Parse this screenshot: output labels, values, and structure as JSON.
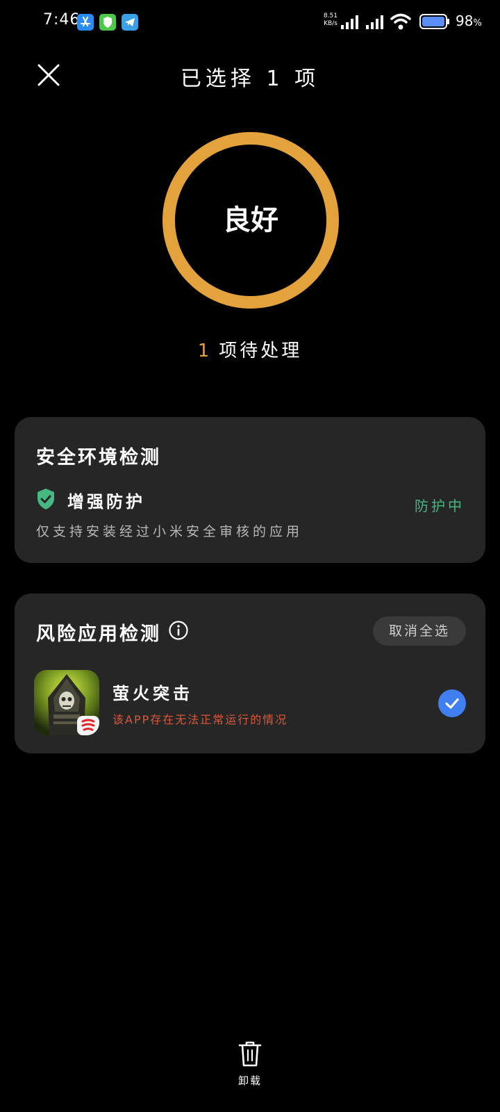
{
  "status_bar": {
    "time": "7:46",
    "network_speed_value": "8.51",
    "network_speed_unit": "KB/s",
    "battery_percent": "98",
    "battery_unit": "%",
    "notification_icons": [
      "app-store-icon",
      "shield-app-icon",
      "telegram-icon"
    ]
  },
  "header": {
    "title": "已选择 1 项",
    "close_icon": "close-icon"
  },
  "status_ring": {
    "label": "良好",
    "ring_color": "#e3a23b"
  },
  "pending": {
    "count": "1",
    "text": "项待处理",
    "count_color": "#e3a23b"
  },
  "security_card": {
    "title": "安全环境检测",
    "item_name": "增强防护",
    "item_status": "防护中",
    "item_description": "仅支持安装经过小米安全审核的应用",
    "status_color": "#47b882",
    "icon": "shield-check-icon"
  },
  "risk_card": {
    "title": "风险应用检测",
    "info_icon": "info-icon",
    "deselect_all_label": "取消全选",
    "apps": [
      {
        "name": "萤火突击",
        "warning": "该APP存在无法正常运行的情况",
        "selected": true,
        "icon": "game-app-icon"
      }
    ],
    "warning_color": "#d9593c",
    "check_color": "#3f7ff2"
  },
  "bottom_action": {
    "label": "卸载",
    "icon": "trash-icon"
  }
}
